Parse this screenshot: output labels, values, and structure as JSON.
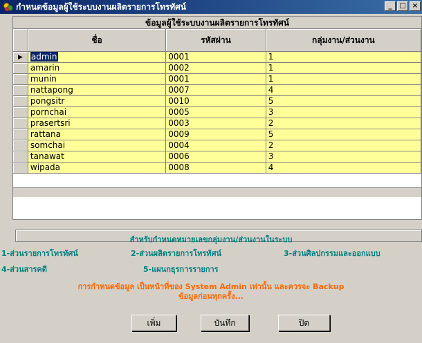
{
  "window": {
    "title": "กำหนดข้อมูลผู้ใช้ระบบงานผลิตรายการโทรทัศน์",
    "buttons": {
      "minimize": "_",
      "maximize": "□",
      "close": "×"
    }
  },
  "grid": {
    "caption": "ข้อมูลผู้ใช้ระบบงานผลิตรายการโทรทัศน์",
    "columns": [
      "ชื่อ",
      "รหัสผ่าน",
      "กลุ่มงาน/ส่วนงาน"
    ],
    "current_row_indicator": "▶",
    "rows": [
      {
        "name": "admin",
        "password": "0001",
        "group": "1"
      },
      {
        "name": "amarin",
        "password": "0002",
        "group": "1"
      },
      {
        "name": "munin",
        "password": "0001",
        "group": "1"
      },
      {
        "name": "nattapong",
        "password": "0007",
        "group": "4"
      },
      {
        "name": "pongsitr",
        "password": "0010",
        "group": "5"
      },
      {
        "name": "pornchai",
        "password": "0005",
        "group": "3"
      },
      {
        "name": "prasertsri",
        "password": "0003",
        "group": "2"
      },
      {
        "name": "rattana",
        "password": "0009",
        "group": "5"
      },
      {
        "name": "somchai",
        "password": "0004",
        "group": "2"
      },
      {
        "name": "tanawat",
        "password": "0006",
        "group": "3"
      },
      {
        "name": "wipada",
        "password": "0008",
        "group": "4"
      }
    ]
  },
  "legend": {
    "title": "สำหรับกำหนดหมายเลขกลุ่มงาน/ส่วนงานในระบบ",
    "items": [
      "1-ส่วนรายการโทรทัศน์",
      "2-ส่วนผลิตรายการโทรทัศน์",
      "3-ส่วนศิลปกรรมและออกแบบ",
      "4-ส่วนสารคดี",
      "5-แผนกธุรการรายการ"
    ]
  },
  "note": {
    "line1": "การกำหนดข้อมูล เป็นหน้าที่ของ System Admin เท่านั้น และควรจะ Backup",
    "line2": "ข้อมูลก่อนทุกครั้ง..."
  },
  "actions": {
    "add": "เพิ่ม",
    "save": "บันทึก",
    "close": "ปิด"
  },
  "colors": {
    "title_bar": "#0a246a",
    "cell_background": "#ffff99",
    "legend_text": "#008080",
    "note_text": "#ff6600"
  }
}
